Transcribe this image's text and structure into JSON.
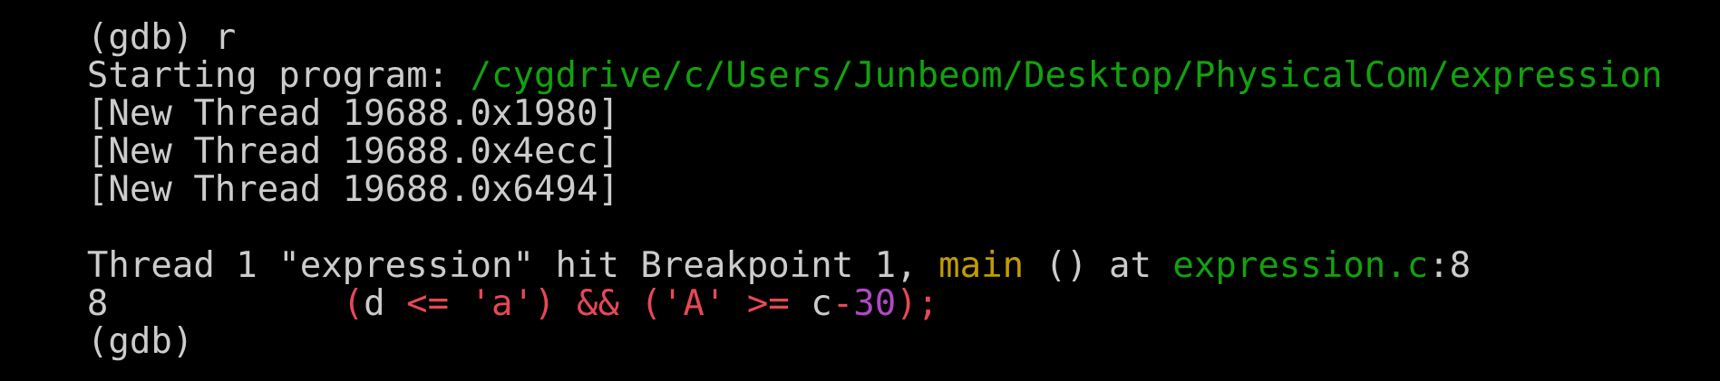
{
  "colors": {
    "background": "#000000",
    "default_text": "#cccccc",
    "path_green": "#13a10e",
    "function_yellow": "#c19c00",
    "syntax_red": "#e74856",
    "number_purple": "#b148c6"
  },
  "terminal": {
    "lines": [
      {
        "name": "command-line",
        "segments": [
          {
            "text": "(gdb) r",
            "color": "default_text"
          }
        ]
      },
      {
        "name": "starting-program-line",
        "segments": [
          {
            "text": "Starting program: ",
            "color": "default_text"
          },
          {
            "text": "/cygdrive/c/Users/Junbeom/Desktop/PhysicalCom/expression",
            "color": "path_green"
          }
        ]
      },
      {
        "name": "new-thread-line-1",
        "segments": [
          {
            "text": "[New Thread 19688.0x1980]",
            "color": "default_text"
          }
        ]
      },
      {
        "name": "new-thread-line-2",
        "segments": [
          {
            "text": "[New Thread 19688.0x4ecc]",
            "color": "default_text"
          }
        ]
      },
      {
        "name": "new-thread-line-3",
        "segments": [
          {
            "text": "[New Thread 19688.0x6494]",
            "color": "default_text"
          }
        ]
      },
      {
        "name": "blank-line",
        "segments": []
      },
      {
        "name": "breakpoint-hit-line",
        "segments": [
          {
            "text": "Thread 1 \"expression\" hit Breakpoint 1, ",
            "color": "default_text"
          },
          {
            "text": "main",
            "color": "function_yellow"
          },
          {
            "text": " () at ",
            "color": "default_text"
          },
          {
            "text": "expression.c",
            "color": "path_green"
          },
          {
            "text": ":8",
            "color": "default_text"
          }
        ]
      },
      {
        "name": "source-line",
        "segments": [
          {
            "text": "8",
            "color": "default_text"
          },
          {
            "text": "           ",
            "color": "default_text"
          },
          {
            "text": "(",
            "color": "syntax_red"
          },
          {
            "text": "d ",
            "color": "default_text"
          },
          {
            "text": "<= 'a') && ('A' >= ",
            "color": "syntax_red"
          },
          {
            "text": "c",
            "color": "default_text"
          },
          {
            "text": "-",
            "color": "syntax_red"
          },
          {
            "text": "30",
            "color": "number_purple"
          },
          {
            "text": ");",
            "color": "syntax_red"
          }
        ]
      },
      {
        "name": "prompt-line",
        "segments": [
          {
            "text": "(gdb)",
            "color": "default_text"
          }
        ]
      }
    ]
  }
}
